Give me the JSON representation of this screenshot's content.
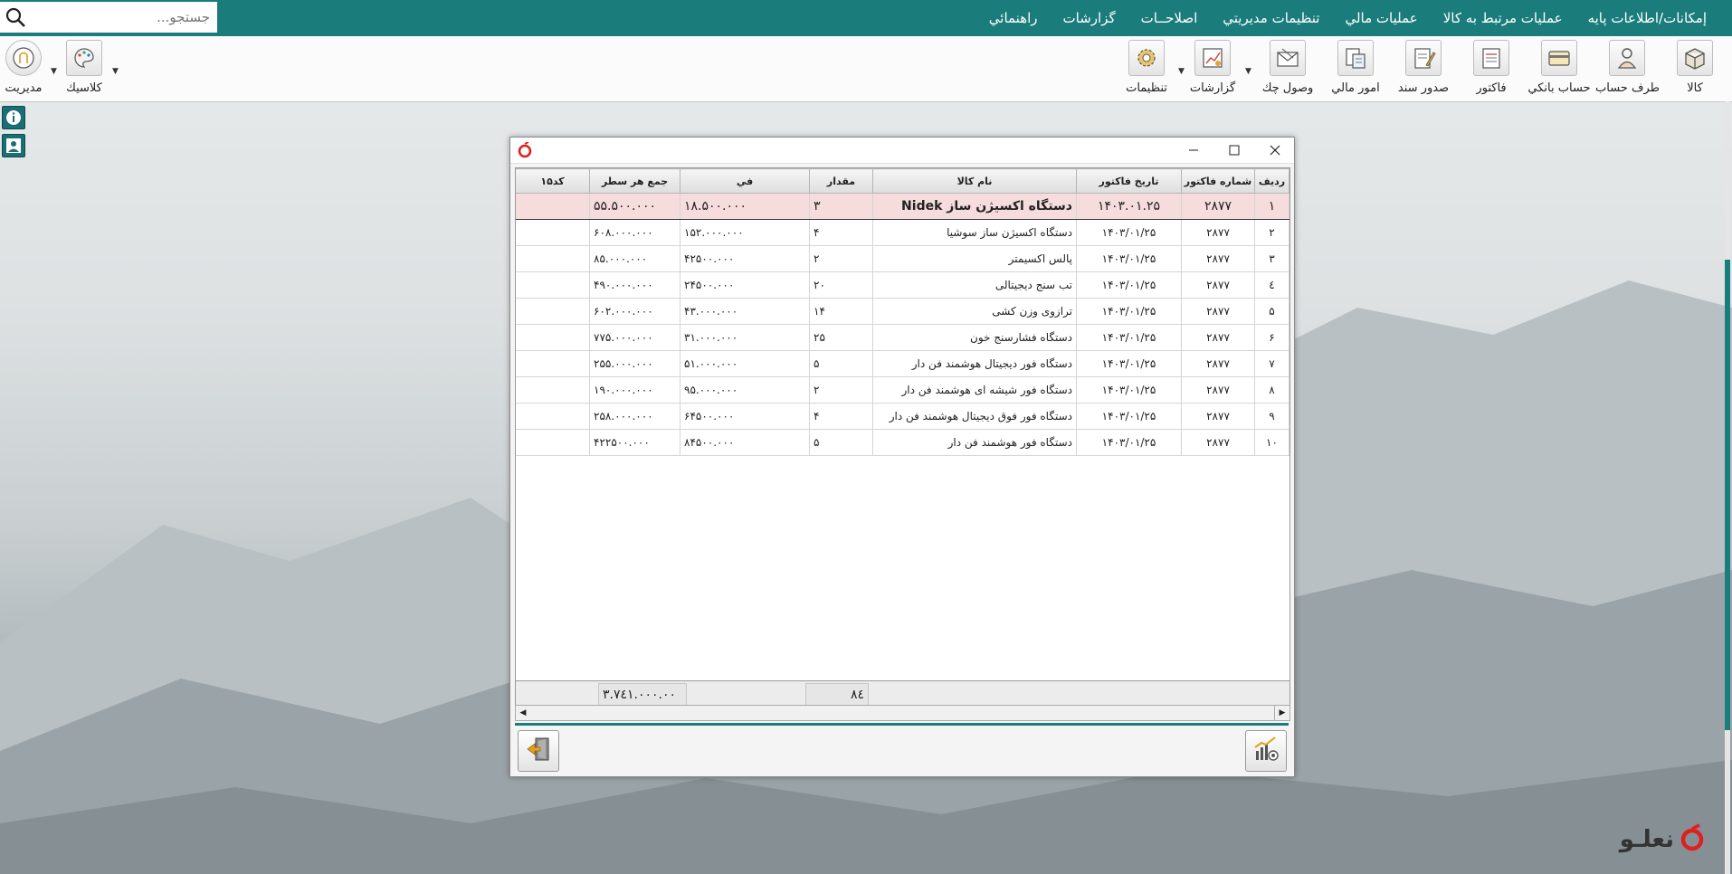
{
  "menubar": {
    "items": [
      "إمكانات/اطلاعات پايه",
      "عمليات مرتبط به كالا",
      "عمليات مالي",
      "تنظيمات مديريتي",
      "اصلاحــات",
      "گزارشات",
      "راهنمائي"
    ],
    "search_placeholder": "جستجو..."
  },
  "toolbar": {
    "right": [
      "كالا",
      "طرف حساب",
      "حساب بانكي",
      "فاكتور",
      "صدور سند",
      "امور مالي",
      "وصول چك",
      "گزارشات",
      "تنظيمات"
    ],
    "left": [
      "كلاسيك",
      "مديريت"
    ]
  },
  "grid": {
    "headers": [
      "رديف",
      "شماره فاكتور",
      "تاريخ فاكتور",
      "نام كالا",
      "مقدار",
      "في",
      "جمع هر سطر",
      "کد۱۵"
    ],
    "rows": [
      [
        "۱",
        "۲۸۷۷",
        "۱۴۰۳.۰۱.۲۵",
        "دستگاه اکسیژن ساز Nidek",
        "۳",
        "۱۸.۵۰۰.۰۰۰",
        "۵۵.۵۰۰.۰۰۰",
        ""
      ],
      [
        "۲",
        "۲۸۷۷",
        "۱۴۰۳/۰۱/۲۵",
        "دستگاه اکسیژن ساز سوشیا",
        "۴",
        "۱۵۲.۰۰۰.۰۰۰",
        "۶۰۸.۰۰۰.۰۰۰",
        ""
      ],
      [
        "۳",
        "۲۸۷۷",
        "۱۴۰۳/۰۱/۲۵",
        "پالس اکسیمتر",
        "۲",
        "۴۲۵۰۰.۰۰۰",
        "۸۵.۰۰۰.۰۰۰",
        ""
      ],
      [
        "٤",
        "۲۸۷۷",
        "۱۴۰۳/۰۱/۲۵",
        "تب سنج دیجیتالی",
        "۲۰",
        "۲۴۵۰۰.۰۰۰",
        "۴۹۰.۰۰۰.۰۰۰",
        ""
      ],
      [
        "۵",
        "۲۸۷۷",
        "۱۴۰۳/۰۱/۲۵",
        "ترازوی وزن کشی",
        "۱۴",
        "۴۳.۰۰۰.۰۰۰",
        "۶۰۲.۰۰۰.۰۰۰",
        ""
      ],
      [
        "۶",
        "۲۸۷۷",
        "۱۴۰۳/۰۱/۲۵",
        "دستگاه فشارسنج خون",
        "۲۵",
        "۳۱.۰۰۰.۰۰۰",
        "۷۷۵.۰۰۰.۰۰۰",
        ""
      ],
      [
        "۷",
        "۲۸۷۷",
        "۱۴۰۳/۰۱/۲۵",
        "دستگاه فور دیجیتال هوشمند فن دار",
        "۵",
        "۵۱.۰۰۰.۰۰۰",
        "۲۵۵.۰۰۰.۰۰۰",
        ""
      ],
      [
        "۸",
        "۲۸۷۷",
        "۱۴۰۳/۰۱/۲۵",
        "دستگاه فور شیشه ای هوشمند فن دار",
        "۲",
        "۹۵.۰۰۰.۰۰۰",
        "۱۹۰.۰۰۰.۰۰۰",
        ""
      ],
      [
        "۹",
        "۲۸۷۷",
        "۱۴۰۳/۰۱/۲۵",
        "دستگاه فور فوق دیجیتال هوشمند فن دار",
        "۴",
        "۶۴۵۰۰.۰۰۰",
        "۲۵۸.۰۰۰.۰۰۰",
        ""
      ],
      [
        "۱۰",
        "۲۸۷۷",
        "۱۴۰۳/۰۱/۲۵",
        "دستگاه فور هوشمند فن دار",
        "۵",
        "۸۴۵۰۰.۰۰۰",
        "۴۲۲۵۰۰.۰۰۰",
        ""
      ]
    ],
    "total_qty": "۸٤",
    "total_sum": "۳.۷٤۱.۰۰۰.۰۰"
  },
  "brand": {
    "name": "نعلـو"
  }
}
